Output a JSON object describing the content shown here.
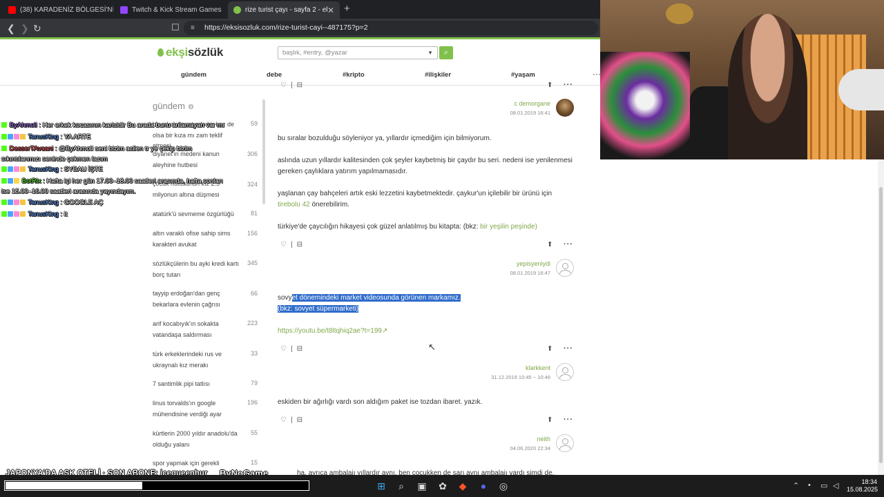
{
  "browser": {
    "tabs": [
      {
        "label": "(38) KARADENİZ BÖLGESİ'NİN EN D…",
        "color": "#ff0000"
      },
      {
        "label": "Twitch & Kick Stream Games",
        "color": "#9146ff"
      },
      {
        "label": "rize turist çayı - sayfa 2 - ekşi sö…",
        "color": "#81c14b"
      }
    ],
    "tab_close": "✕",
    "new_tab": "+",
    "url": "https://eksisozluk.com/rize-turist-cayi--487175?p=2"
  },
  "site": {
    "logo_prefix": "ekşi",
    "logo_suffix": "sözlük",
    "search_placeholder": "başlık, #entry, @yazar",
    "nav": [
      "gündem",
      "debe",
      "#kripto",
      "#ilişkiler",
      "#yaşam"
    ],
    "nav_more": "···",
    "accent": "#81c14b"
  },
  "sidebar": {
    "title": "gündem",
    "items": [
      {
        "title": "bir erkek hayatında bir kez de olsa bir kıza mı zam teklif etmesi",
        "count": "59"
      },
      {
        "title": "diyanet'in medeni kanun aleyhine hutbesi",
        "count": "306"
      },
      {
        "title": "çocuk nüfusunun kız 2.5 milyonun altına düşmesi",
        "count": "324"
      },
      {
        "title": "atatürk'ü sevmeme özgürlüğü",
        "count": "81"
      },
      {
        "title": "altın varaklı ofise sahip sims karakteri avukat",
        "count": "156"
      },
      {
        "title": "sözlükçülerin bu ayki kredi kartı borç tutarı",
        "count": "345"
      },
      {
        "title": "tayyip erdoğan'dan genç bekarlara evlenin çağrısı",
        "count": "66"
      },
      {
        "title": "arif kocabıyık'ın sokakta vatandaşa saldırması",
        "count": "223"
      },
      {
        "title": "türk erkeklerindeki rus ve ukraynalı kız merakı",
        "count": "33"
      },
      {
        "title": "7 santimlik pipi tatlısı",
        "count": "79"
      },
      {
        "title": "linus torvalds'ın google mühendisine verdiği ayar",
        "count": "196"
      },
      {
        "title": "kürtlerin 2000 yıldır anadolu'da olduğu yalanı",
        "count": "55"
      },
      {
        "title": "spor yapmak için gerekli",
        "count": "15"
      }
    ]
  },
  "entries": [
    {
      "author": "c demorgane",
      "date": "08.01.2019 16:41"
    },
    {
      "p1": "bu sıralar bozulduğu söyleniyor ya, yıllardır içmediğim için bilmiyorum.",
      "p2": "aslında uzun yıllardır kalitesinden çok şeyler kaybetmiş bir çaydır bu seri. nedeni ise yenilenmesi gereken çaylıklara yatırım yapılmamasıdır.",
      "p3a": "yaşlanan çay bahçeleri artık eski lezzetini kaybetmektedir. çaykur'un içilebilir bir ürünü için",
      "p3link": "tirebolu 42",
      "p3b": "önerebilirim.",
      "p4a": "türkiye'de çaycılığın hikayesi çok güzel anlatılmış bu kitapta: (bkz:",
      "p4link": "bir yeşilin peşinde",
      "p4b": ")",
      "author": "yepisyeniydi",
      "date": "08.01.2019 16:47"
    },
    {
      "pre": "sovy",
      "selected1": "et dönemindeki market videosunda görünen markamız.",
      "selected2": "(bkz: sovyet süpermarketi)",
      "link": "https://youtu.be/t8ltqhiq2ae?t=199",
      "author": "klarkkent",
      "date": "31.12.2019 10:45 ~ 10:46"
    },
    {
      "text": "eskiden bir ağırlığı vardı son aldığım paket ise tozdan ibaret. yazık.",
      "author": "neith",
      "date": "04.06.2020 22:34"
    },
    {
      "text": "ha, ayrıca ambalajı yıllardır aynı. ben çocukken de sarı aynı ambalajı vardı şimdi de."
    }
  ],
  "chat": [
    {
      "user": "ByAhmoli",
      "user_color": "#b388ff",
      "text": "Her erkek kocasının karisidir Bu arada bunu anlamayan var mı"
    },
    {
      "user": "TanusKing",
      "user_color": "#6fa8ff",
      "text": "YA ARTE"
    },
    {
      "user": "DesserTAvcani",
      "user_color": "#ff6b6b",
      "text": "@ByAhmoli seni bizim acilen tr ye çekip bizim sıkıntılarımızı seninde çekmen lazım"
    },
    {
      "user": "TanusKing",
      "user_color": "#6fa8ff",
      "text": "SYBAU İŞTE"
    },
    {
      "user": "BotRix",
      "user_color": "#7cff4f",
      "text": "Hafta içi her gün 17.00–18.00 saatleri arasında, hafta sonları ise 15.00–16.00 saatleri arasında yayındayım."
    },
    {
      "user": "TanusKing",
      "user_color": "#6fa8ff",
      "text": "GOOGLE AÇ"
    },
    {
      "user": "TanusKing",
      "user_color": "#6fa8ff",
      "text": "it"
    }
  ],
  "stream": {
    "ticker": "JAPONYA'DA AŞK OTELİ · SON ABONE: icequeenhur",
    "brand": "ByNoGame",
    "progress_fraction": 0.45
  },
  "taskbar": {
    "time": "18:34",
    "date": "15.08.2025"
  }
}
